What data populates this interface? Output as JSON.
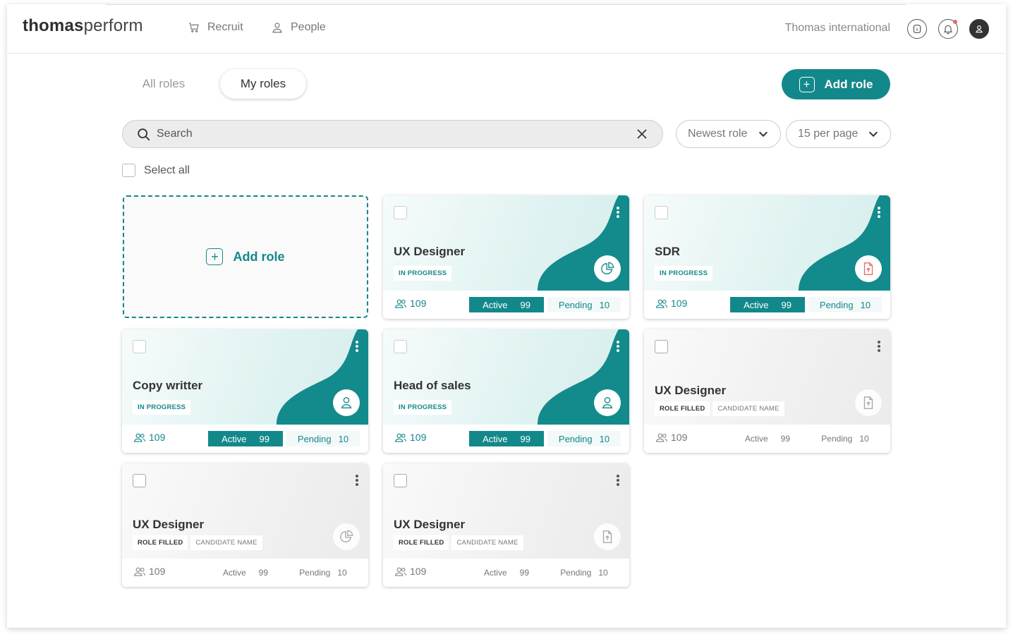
{
  "header": {
    "logo_bold": "thomas",
    "logo_light": "perform",
    "nav": [
      {
        "label": "Recruit",
        "icon": "cart-icon"
      },
      {
        "label": "People",
        "icon": "person-icon"
      }
    ],
    "org": "Thomas international",
    "icons": [
      "info-icon",
      "bell-icon",
      "user-avatar-icon"
    ]
  },
  "tabs": {
    "all": "All roles",
    "my": "My roles",
    "active": "my"
  },
  "add_role_button": "Add role",
  "search": {
    "placeholder": "Search"
  },
  "sort": {
    "label": "Newest role"
  },
  "per_page": {
    "label": "15 per page"
  },
  "select_all": "Select all",
  "add_role_card": "Add role",
  "colors": {
    "accent": "#13888a"
  },
  "cards": [
    {
      "title": "UX Designer",
      "badges": [
        "IN PROGRESS"
      ],
      "status": "progress",
      "icon": "pie-chart-icon",
      "people": "109",
      "active_label": "Active",
      "active": "99",
      "pending_label": "Pending",
      "pending": "10"
    },
    {
      "title": "SDR",
      "badges": [
        "IN PROGRESS"
      ],
      "status": "progress",
      "icon": "file-upload-icon",
      "people": "109",
      "active_label": "Active",
      "active": "99",
      "pending_label": "Pending",
      "pending": "10"
    },
    {
      "title": "Copy writter",
      "badges": [
        "IN PROGRESS"
      ],
      "status": "progress",
      "icon": "person-icon",
      "people": "109",
      "active_label": "Active",
      "active": "99",
      "pending_label": "Pending",
      "pending": "10"
    },
    {
      "title": "Head of sales",
      "badges": [
        "IN PROGRESS"
      ],
      "status": "progress",
      "icon": "person-icon",
      "people": "109",
      "active_label": "Active",
      "active": "99",
      "pending_label": "Pending",
      "pending": "10"
    },
    {
      "title": "UX Designer",
      "badges": [
        "ROLE FILLED",
        "CANDIDATE NAME"
      ],
      "status": "filled",
      "icon": "file-upload-icon",
      "people": "109",
      "active_label": "Active",
      "active": "99",
      "pending_label": "Pending",
      "pending": "10"
    },
    {
      "title": "UX Designer",
      "badges": [
        "ROLE FILLED",
        "CANDIDATE NAME"
      ],
      "status": "filled",
      "icon": "pie-chart-icon",
      "people": "109",
      "active_label": "Active",
      "active": "99",
      "pending_label": "Pending",
      "pending": "10"
    },
    {
      "title": "UX Designer",
      "badges": [
        "ROLE FILLED",
        "CANDIDATE NAME"
      ],
      "status": "filled",
      "icon": "file-upload-icon",
      "people": "109",
      "active_label": "Active",
      "active": "99",
      "pending_label": "Pending",
      "pending": "10"
    }
  ]
}
